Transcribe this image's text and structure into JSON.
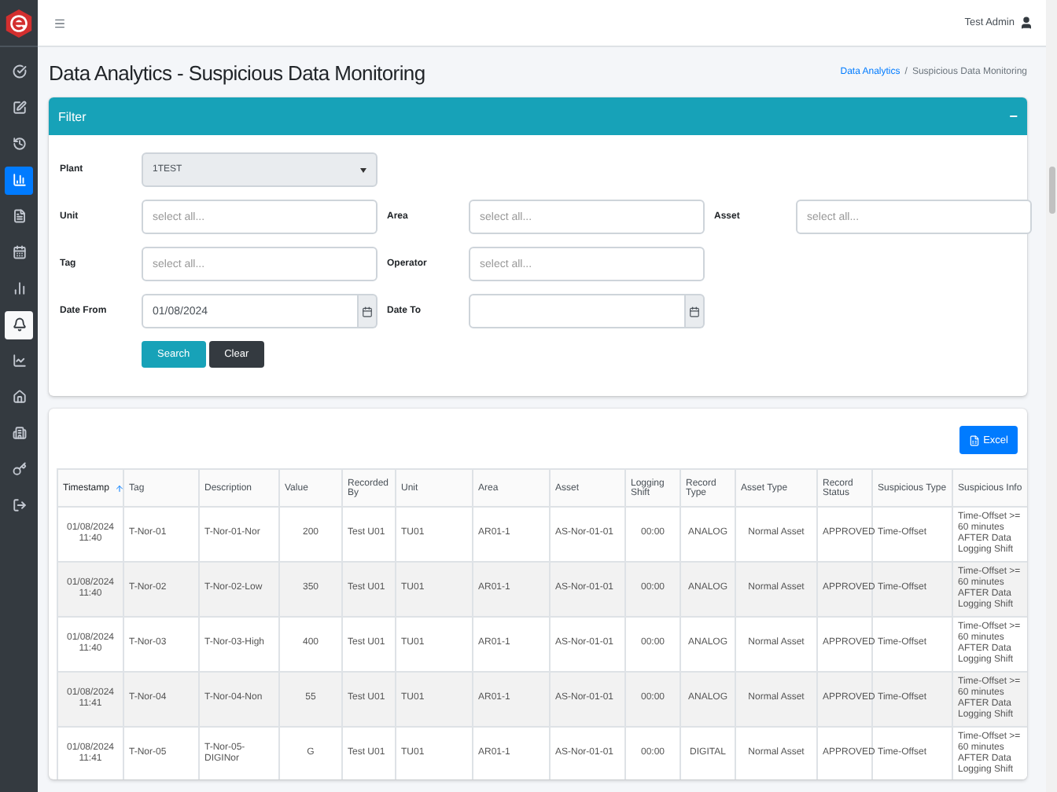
{
  "sidebar": {
    "items": [
      {
        "kind": "check",
        "selected": false,
        "hovered": false
      },
      {
        "kind": "edit",
        "selected": false,
        "hovered": false
      },
      {
        "kind": "history",
        "selected": false,
        "hovered": false
      },
      {
        "kind": "chart",
        "selected": true,
        "hovered": false
      },
      {
        "kind": "file",
        "selected": false,
        "hovered": false
      },
      {
        "kind": "calendar",
        "selected": false,
        "hovered": false
      },
      {
        "kind": "bars",
        "selected": false,
        "hovered": false
      },
      {
        "kind": "bell",
        "selected": false,
        "hovered": true
      },
      {
        "kind": "trend",
        "selected": false,
        "hovered": false
      },
      {
        "kind": "home",
        "selected": false,
        "hovered": false
      },
      {
        "kind": "building",
        "selected": false,
        "hovered": false
      },
      {
        "kind": "key",
        "selected": false,
        "hovered": false
      },
      {
        "kind": "logout",
        "selected": false,
        "hovered": false
      }
    ]
  },
  "topbar": {
    "user": "Test Admin"
  },
  "page": {
    "title": "Data Analytics - Suspicious Data Monitoring",
    "breadcrumb": [
      {
        "label": "Data Analytics",
        "link": true
      },
      {
        "label": "Suspicious Data Monitoring",
        "link": false
      }
    ],
    "separator": "/"
  },
  "filter": {
    "title": "Filter",
    "collapse": "−",
    "fields": [
      {
        "label": "Plant",
        "kind": "select",
        "value": "1TEST"
      },
      {
        "kind": "blank"
      },
      {
        "kind": "blank"
      },
      {
        "label": "Unit",
        "kind": "input",
        "placeholder": "select all..."
      },
      {
        "label": "Area",
        "kind": "input",
        "placeholder": "select all..."
      },
      {
        "label": "Asset",
        "kind": "input",
        "placeholder": "select all..."
      },
      {
        "label": "Tag",
        "kind": "input",
        "placeholder": "select all..."
      },
      {
        "label": "Operator",
        "kind": "input",
        "placeholder": "select all..."
      },
      {
        "kind": "blank"
      },
      {
        "label": "Date From",
        "kind": "date",
        "value": "01/08/2024"
      },
      {
        "label": "Date To",
        "kind": "date"
      },
      {
        "kind": "blank"
      }
    ],
    "buttons": [
      {
        "label": "Search",
        "kind": "primary"
      },
      {
        "label": "Clear",
        "kind": "dark"
      }
    ]
  },
  "results": {
    "export": "Excel",
    "columns": [
      {
        "label": "Timestamp",
        "sorted": true
      },
      {
        "label": "Tag",
        "sorted": false
      },
      {
        "label": "Description",
        "sorted": false
      },
      {
        "label": "Value",
        "sorted": false
      },
      {
        "label": "Recorded By",
        "sorted": false
      },
      {
        "label": "Unit",
        "sorted": false
      },
      {
        "label": "Area",
        "sorted": false
      },
      {
        "label": "Asset",
        "sorted": false
      },
      {
        "label": "Logging Shift",
        "sorted": false
      },
      {
        "label": "Record Type",
        "sorted": false
      },
      {
        "label": "Asset Type",
        "sorted": false
      },
      {
        "label": "Record Status",
        "sorted": false
      },
      {
        "label": "Suspicious Type",
        "sorted": false
      },
      {
        "label": "Suspicious Info",
        "sorted": false
      }
    ],
    "rows": [
      [
        "01/08/2024 11:40",
        "T-Nor-01",
        "T-Nor-01-Nor",
        "200",
        "Test U01",
        "TU01",
        "AR01-1",
        "AS-Nor-01-01",
        "00:00",
        "ANALOG",
        "Normal Asset",
        "APPROVED",
        "Time-Offset",
        "Time-Offset >= 60 minutes AFTER Data Logging Shift"
      ],
      [
        "01/08/2024 11:40",
        "T-Nor-02",
        "T-Nor-02-Low",
        "350",
        "Test U01",
        "TU01",
        "AR01-1",
        "AS-Nor-01-01",
        "00:00",
        "ANALOG",
        "Normal Asset",
        "APPROVED",
        "Time-Offset",
        "Time-Offset >= 60 minutes AFTER Data Logging Shift"
      ],
      [
        "01/08/2024 11:40",
        "T-Nor-03",
        "T-Nor-03-High",
        "400",
        "Test U01",
        "TU01",
        "AR01-1",
        "AS-Nor-01-01",
        "00:00",
        "ANALOG",
        "Normal Asset",
        "APPROVED",
        "Time-Offset",
        "Time-Offset >= 60 minutes AFTER Data Logging Shift"
      ],
      [
        "01/08/2024 11:41",
        "T-Nor-04",
        "T-Nor-04-Non",
        "55",
        "Test U01",
        "TU01",
        "AR01-1",
        "AS-Nor-01-01",
        "00:00",
        "ANALOG",
        "Normal Asset",
        "APPROVED",
        "Time-Offset",
        "Time-Offset >= 60 minutes AFTER Data Logging Shift"
      ],
      [
        "01/08/2024 11:41",
        "T-Nor-05",
        "T-Nor-05-DIGINor",
        "G",
        "Test U01",
        "TU01",
        "AR01-1",
        "AS-Nor-01-01",
        "00:00",
        "DIGITAL",
        "Normal Asset",
        "APPROVED",
        "Time-Offset",
        "Time-Offset >= 60 minutes AFTER Data Logging Shift"
      ]
    ]
  }
}
